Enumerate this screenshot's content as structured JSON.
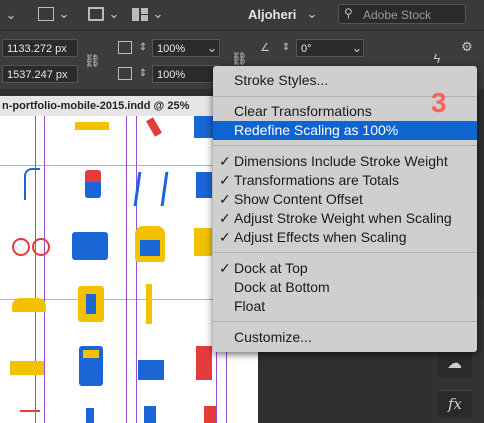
{
  "topbar": {
    "user": "Aljoheri",
    "search_placeholder": "Adobe Stock"
  },
  "controls": {
    "x_value": "1133.272 px",
    "y_value": "1537.247 px",
    "scale_x": "100%",
    "scale_y": "100%",
    "rotation": "0°"
  },
  "document": {
    "tab_title": "n-portfolio-mobile-2015.indd @ 25%"
  },
  "menu": {
    "items": [
      {
        "label": "Stroke Styles...",
        "checked": ""
      },
      {
        "label": "Clear Transformations",
        "checked": ""
      },
      {
        "label": "Redefine Scaling as 100%",
        "checked": ""
      },
      {
        "label": "Dimensions Include Stroke Weight",
        "checked": "✓"
      },
      {
        "label": "Transformations are Totals",
        "checked": "✓"
      },
      {
        "label": "Show Content Offset",
        "checked": "✓"
      },
      {
        "label": "Adjust Stroke Weight when Scaling",
        "checked": "✓"
      },
      {
        "label": "Adjust Effects when Scaling",
        "checked": "✓"
      },
      {
        "label": "Dock at Top",
        "checked": "✓"
      },
      {
        "label": "Dock at Bottom",
        "checked": ""
      },
      {
        "label": "Float",
        "checked": ""
      },
      {
        "label": "Customize...",
        "checked": ""
      }
    ]
  },
  "annotation": "3",
  "panel": {
    "fx_label": "fx"
  }
}
